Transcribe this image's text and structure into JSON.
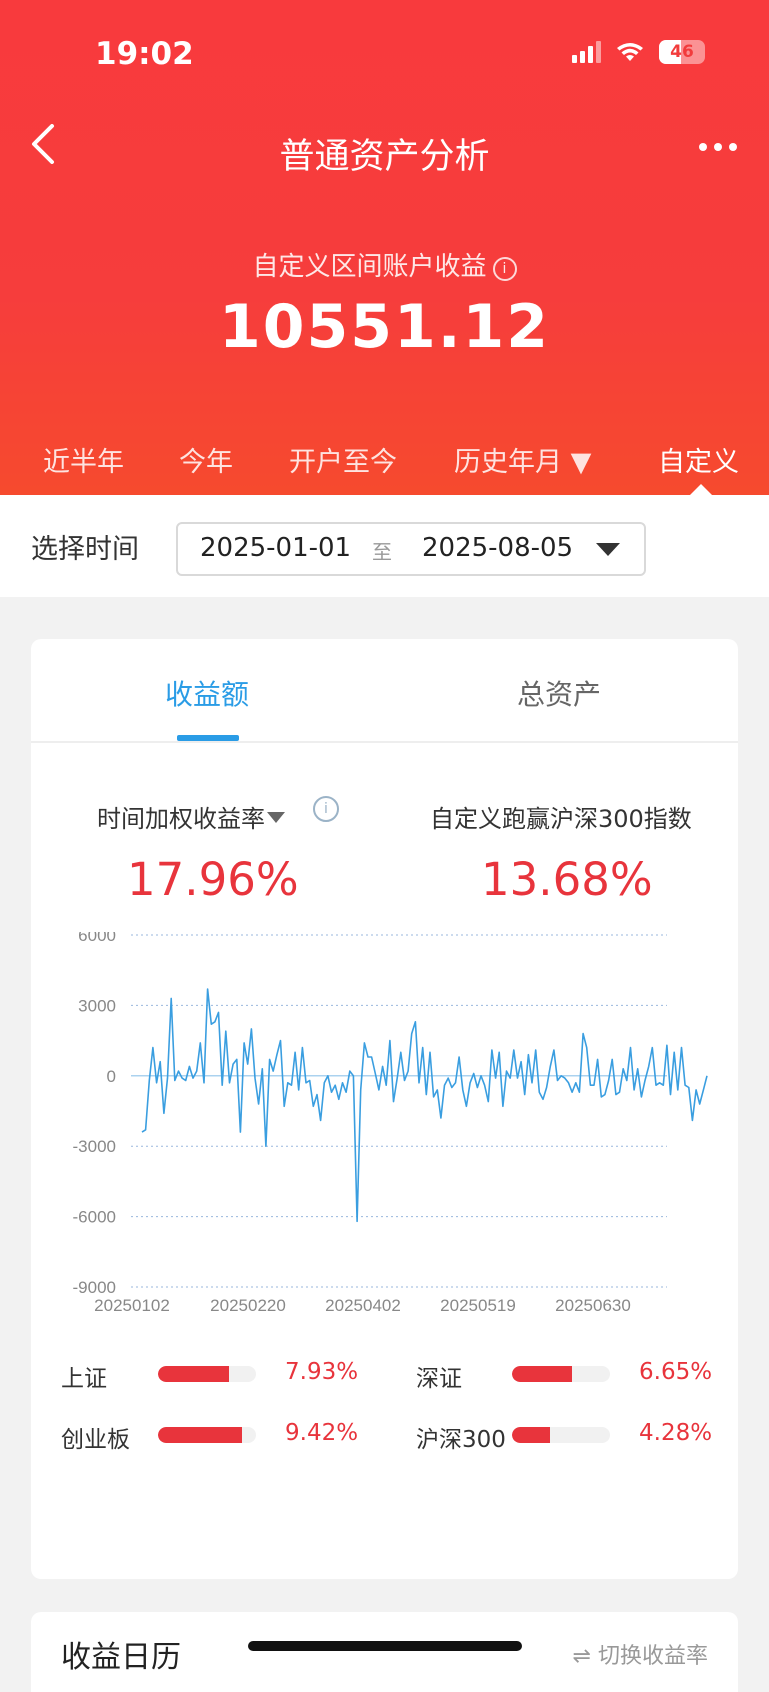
{
  "status": {
    "time": "19:02",
    "battery": "46"
  },
  "nav": {
    "title": "普通资产分析"
  },
  "summary": {
    "label": "自定义区间账户收益",
    "value": "10551.12"
  },
  "periods": [
    "近半年",
    "今年",
    "开户至今",
    "历史年月 ▼",
    "自定义"
  ],
  "date_filter": {
    "label": "选择时间",
    "start": "2025-01-01",
    "separator": "至",
    "end": "2025-08-05"
  },
  "tabs": [
    "收益额",
    "总资产"
  ],
  "metrics": {
    "left_label": "时间加权收益率",
    "left_value": "17.96%",
    "right_label": "自定义跑赢沪深300指数",
    "right_value": "13.68%"
  },
  "chart_data": {
    "type": "line",
    "ylim": [
      -9000,
      6000
    ],
    "yticks": [
      "6000",
      "3000",
      "0",
      "-3000",
      "-6000",
      "-9000"
    ],
    "xticks": [
      "20250102",
      "20250220",
      "20250402",
      "20250519",
      "20250630"
    ],
    "series": [
      {
        "color": "#3a9ee0",
        "values": [
          -2400,
          -2300,
          -200,
          1200,
          -300,
          600,
          -1600,
          -100,
          3300,
          -200,
          200,
          -100,
          -200,
          400,
          -100,
          200,
          1400,
          -300,
          3700,
          2200,
          2300,
          2700,
          -400,
          1900,
          -300,
          500,
          700,
          -2400,
          1400,
          500,
          2000,
          -100,
          -1200,
          300,
          -3000,
          700,
          200,
          900,
          1500,
          -1300,
          -300,
          -400,
          1000,
          -600,
          1200,
          -300,
          -200,
          -1300,
          -800,
          -1900,
          -300,
          0,
          -700,
          -400,
          -1000,
          -300,
          -700,
          200,
          0,
          -6200,
          -600,
          1400,
          800,
          800,
          100,
          -600,
          400,
          -400,
          1500,
          -1100,
          -100,
          1000,
          -200,
          200,
          1800,
          2300,
          -300,
          1200,
          -800,
          1000,
          -900,
          -600,
          -1800,
          -400,
          -100,
          -500,
          -300,
          800,
          -600,
          -1300,
          -300,
          100,
          -500,
          0,
          -400,
          -1100,
          1100,
          -100,
          1000,
          -1300,
          200,
          -100,
          1100,
          -100,
          600,
          -800,
          900,
          -300,
          1100,
          -700,
          -1000,
          -500,
          400,
          1100,
          -200,
          0,
          -100,
          -300,
          -700,
          -300,
          -700,
          1800,
          1200,
          -400,
          -400,
          700,
          -900,
          -800,
          -200,
          700,
          -800,
          -700,
          300,
          -200,
          1200,
          -600,
          300,
          -900,
          -200,
          400,
          1200,
          -400,
          -300,
          -400,
          1300,
          -800,
          1000,
          -600,
          1200,
          -400,
          -500,
          -1900,
          -600,
          -1200,
          -600,
          0
        ]
      }
    ]
  },
  "indices": [
    {
      "name": "上证",
      "value": "7.93%",
      "fraction": 0.72
    },
    {
      "name": "深证",
      "value": "6.65%",
      "fraction": 0.61
    },
    {
      "name": "创业板",
      "value": "9.42%",
      "fraction": 0.86
    },
    {
      "name": "沪深300",
      "value": "4.28%",
      "fraction": 0.39
    }
  ],
  "calendar": {
    "title": "收益日历",
    "switch_label": "切换收益率"
  }
}
